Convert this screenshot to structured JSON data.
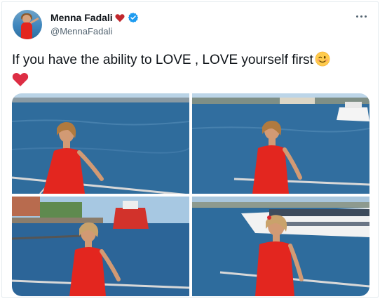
{
  "author": {
    "display_name": "Menna Fadali",
    "handle": "@MennaFadali",
    "name_emoji": "red-heart",
    "verified": true
  },
  "tweet": {
    "text": "If you have the ability to LOVE , LOVE yourself first",
    "trailing_emojis": [
      "winking-face",
      "red-heart"
    ]
  },
  "media": {
    "photo_count": 4,
    "photos": [
      {
        "subject": "woman-in-red-dress-on-boat-railing"
      },
      {
        "subject": "woman-in-red-dress-smiling-sea-background"
      },
      {
        "subject": "woman-in-red-dress-harbor-with-red-ship"
      },
      {
        "subject": "woman-in-red-dress-near-ferry"
      }
    ]
  },
  "colors": {
    "text": "#0f1419",
    "secondary_text": "#536471",
    "verified_blue": "#1d9bf0",
    "heart_red": "#e0245e",
    "sea_blue": "#2f6c9c",
    "dress_red": "#e3261f"
  }
}
